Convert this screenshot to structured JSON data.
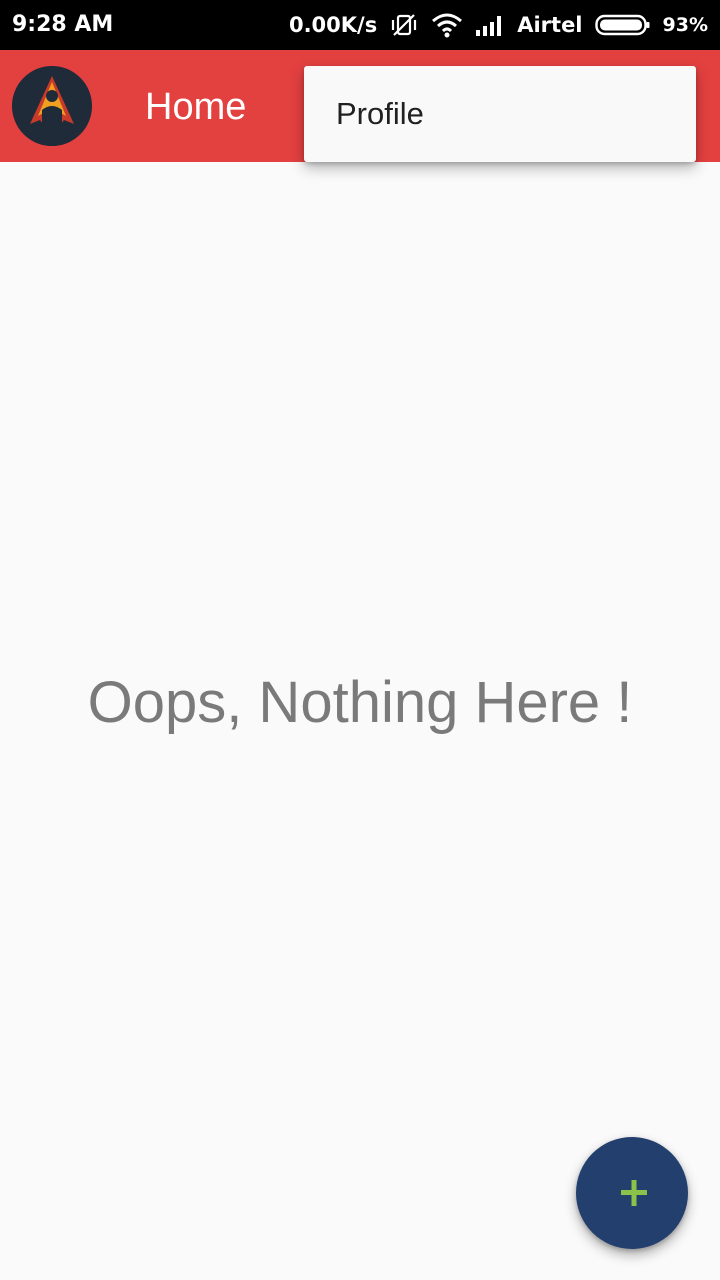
{
  "status_bar": {
    "time": "9:28 AM",
    "network_speed": "0.00K/s",
    "carrier": "Airtel",
    "battery": "93%",
    "icons": [
      "vibrate-off-icon",
      "wifi-icon",
      "signal-icon",
      "battery-icon"
    ]
  },
  "app_bar": {
    "title": "Home",
    "color": "#e34040"
  },
  "overflow_menu": {
    "items": [
      {
        "label": "Profile"
      }
    ]
  },
  "main": {
    "empty_message": "Oops, Nothing Here !"
  },
  "fab": {
    "icon": "plus-icon",
    "color": "#233f6e",
    "icon_color": "#8bc34a"
  }
}
